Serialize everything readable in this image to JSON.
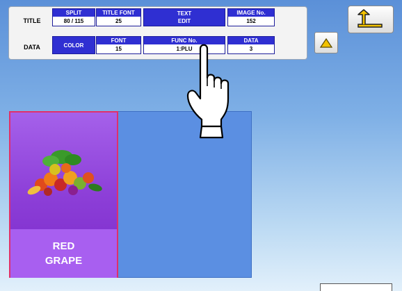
{
  "panel": {
    "row1_label": "TITLE",
    "row2_label": "DATA",
    "split": {
      "label": "SPLIT",
      "value": "80 / 115"
    },
    "title_font": {
      "label": "TITLE FONT",
      "value": "25"
    },
    "text_edit": {
      "line1": "TEXT",
      "line2": "EDIT"
    },
    "image_no": {
      "label": "IMAGE No.",
      "value": "152"
    },
    "color_label": "COLOR",
    "font": {
      "label": "FONT",
      "value": "15"
    },
    "func_no": {
      "label": "FUNC No.",
      "value": "1:PLU"
    },
    "data": {
      "label": "DATA",
      "value": "3"
    }
  },
  "tile": {
    "line1": "RED",
    "line2": "GRAPE"
  },
  "icons": {
    "back": "return-arrow-icon",
    "up": "triangle-up-icon",
    "pointer": "pointing-hand-icon",
    "produce": "fruit-vegetable-image"
  },
  "colors": {
    "header_blue": "#2f2fd2",
    "tile_purple": "#8d3fd8",
    "tile_border": "#e0306a",
    "canvas_blue": "#5b8fe2",
    "up_triangle": "#f2c200"
  }
}
